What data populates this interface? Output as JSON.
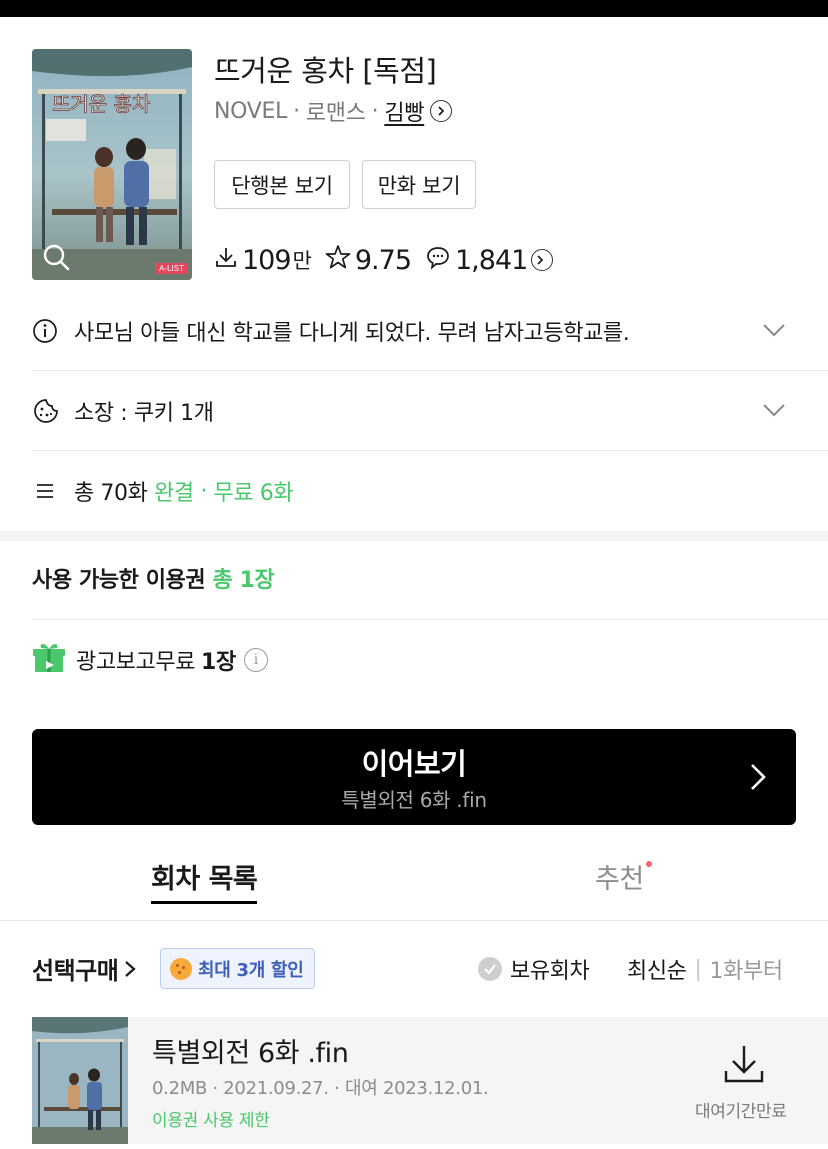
{
  "book": {
    "title": "뜨거운 홍차 [독점]",
    "format": "NOVEL",
    "genre": "로맨스",
    "author": "김빵",
    "cover_badge": "A-LIST",
    "cover_title_art": "뜨거운 홍차"
  },
  "view_buttons": {
    "volume": "단행본 보기",
    "comic": "만화 보기"
  },
  "stats": {
    "downloads": "109",
    "downloads_unit": "만",
    "rating": "9.75",
    "comments": "1,841"
  },
  "info": {
    "synopsis": "사모님 아들 대신 학교를 다니게 되었다. 무려 남자고등학교를.",
    "owned": "소장 : 쿠키 1개",
    "total_prefix": "총 70화",
    "status": "완결",
    "dot": "·",
    "free": "무료 6화"
  },
  "tickets": {
    "heading": "사용 가능한 이용권",
    "count": "총 1장",
    "ad_free_label": "광고보고무료",
    "ad_free_count": "1장"
  },
  "continue": {
    "label": "이어보기",
    "episode": "특별외전 6화 .fin"
  },
  "tabs": {
    "episodes": "회차 목록",
    "recommend": "추천"
  },
  "filters": {
    "select_buy": "선택구매",
    "discount": "최대 3개 할인",
    "owned_episodes": "보유회차",
    "sort_latest": "최신순",
    "sort_separator": "|",
    "sort_first": "1화부터"
  },
  "episodes": [
    {
      "title": "특별외전 6화 .fin",
      "meta": "0.2MB · 2021.09.27. · 대여 2023.12.01.",
      "limit": "이용권 사용 제한",
      "download_label": "대여기간만료"
    }
  ],
  "colors": {
    "accent_green": "#4bc86b",
    "continue_bg": "#000000",
    "discount_bg": "#eef3ff",
    "discount_text": "#3e5fb7",
    "new_dot": "#f06470"
  },
  "icons": [
    "search-icon",
    "chevron-right-icon",
    "download-icon",
    "star-icon",
    "comment-icon",
    "info-icon",
    "cookie-icon",
    "list-icon",
    "chevron-down-icon",
    "gift-icon",
    "check-icon",
    "coin-icon"
  ]
}
